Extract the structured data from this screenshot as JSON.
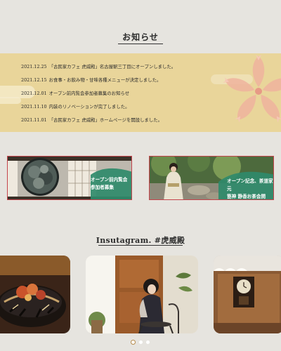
{
  "news": {
    "title": "お知らせ",
    "items": [
      {
        "date": "2021.12.25",
        "text": "「古民家カフェ 虎威殿」名古屋駅三丁目にオープンしました。"
      },
      {
        "date": "2021.12.15",
        "text": "お食事・お飲み物・甘味各種メニューが決定しました。"
      },
      {
        "date": "2021.12.01",
        "text": "オープン前内覧会参加者募集のお知らせ"
      },
      {
        "date": "2021.11.10",
        "text": "内装のリノベーションが完了しました。"
      },
      {
        "date": "2021.11.01",
        "text": "「古民家カフェ 虎威殿」ホームページを開設しました。"
      }
    ]
  },
  "banners": {
    "left_caption_line1": "オープン前内覧会",
    "left_caption_line2": "参加者募集",
    "right_caption_line1": "オープン記念、茶道家元",
    "right_caption_line2": "箆神 静香お茶会開催！"
  },
  "instagram": {
    "title": "Insutagram. #虎威殿"
  },
  "carousel": {
    "active_index": 0,
    "count": 3
  },
  "colors": {
    "background": "#e6e4df",
    "news_band": "#e9d59a",
    "banner_border": "#c4444c",
    "banner_panel": "#2f8a6a",
    "dot_active_ring": "#b58a4a"
  }
}
